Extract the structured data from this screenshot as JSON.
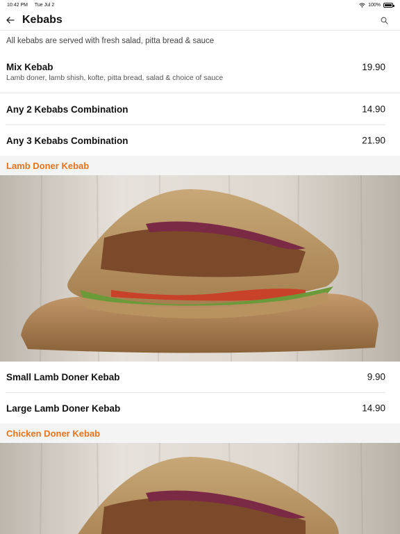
{
  "status_bar": {
    "time": "10:42 PM",
    "date": "Tue Jul 2",
    "battery": "100%"
  },
  "nav": {
    "title": "Kebabs"
  },
  "intro": "All kebabs are served with fresh salad, pitta bread & sauce",
  "items": [
    {
      "name": "Mix Kebab",
      "desc": "Lamb doner, lamb shish, kofte, pitta bread, salad & choice of sauce",
      "price": "19.90"
    },
    {
      "name": "Any 2 Kebabs Combination",
      "price": "14.90"
    },
    {
      "name": "Any 3 Kebabs Combination",
      "price": "21.90"
    }
  ],
  "sections": [
    {
      "title": "Lamb Doner Kebab",
      "items": [
        {
          "name": "Small Lamb Doner Kebab",
          "price": "9.90"
        },
        {
          "name": "Large Lamb Doner Kebab",
          "price": "14.90"
        }
      ]
    },
    {
      "title": "Chicken Doner Kebab",
      "items": []
    }
  ],
  "colors": {
    "accent": "#e8731e",
    "section_bg": "#f4f4f4",
    "separator": "#e6e6e6"
  },
  "icons": {
    "back": "arrow-left-icon",
    "search": "search-icon",
    "wifi": "wifi-icon",
    "battery": "battery-icon"
  }
}
